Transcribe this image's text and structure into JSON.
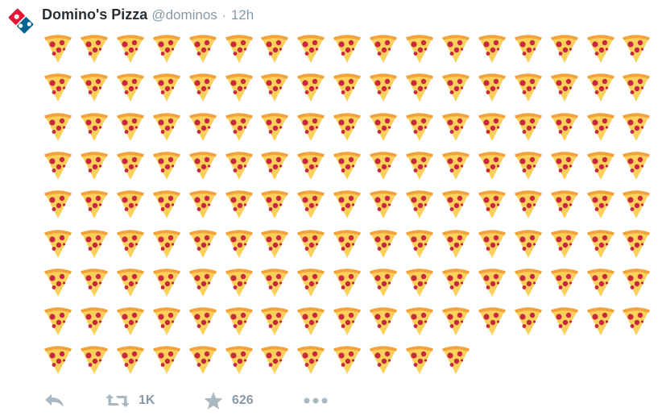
{
  "tweet": {
    "author_name": "Domino's Pizza",
    "handle": "@dominos",
    "separator": "·",
    "time": "12h",
    "emoji_count": 148
  },
  "actions": {
    "retweet_count": "1K",
    "like_count": "626"
  },
  "icons": {
    "avatar": "dominos-logo-icon",
    "emoji": "pizza-slice-icon",
    "reply": "reply-icon",
    "retweet": "retweet-icon",
    "like": "star-icon",
    "more": "more-icon"
  },
  "colors": {
    "brand_blue": "#006491",
    "brand_red": "#e31837",
    "text_dark": "#292f33",
    "text_muted": "#8899a6",
    "icon_muted": "#aab8c2"
  }
}
